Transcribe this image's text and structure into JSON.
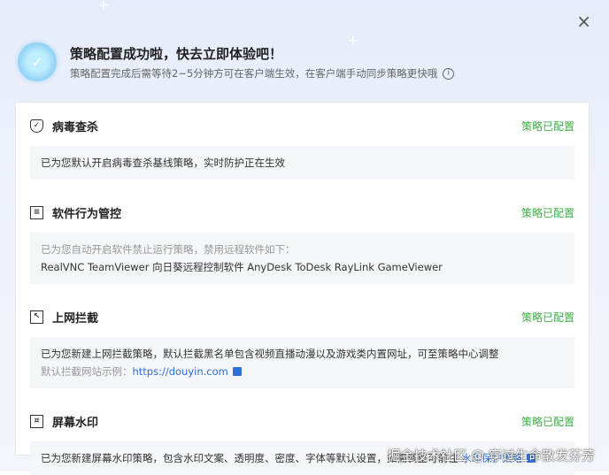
{
  "header": {
    "title": "策略配置成功啦，快去立即体验吧！",
    "subtitle": "策略配置完成后需等待2~5分钟方可在客户端生效，在客户端手动同步策略更快哦",
    "close": "×"
  },
  "sections": [
    {
      "title": "病毒查杀",
      "status": "策略已配置",
      "line1": "已为您默认开启病毒查杀基线策略，实时防护正在生效"
    },
    {
      "title": "软件行为管控",
      "status": "策略已配置",
      "line1": "已为您自动开启软件禁止运行策略，禁用远程软件如下：",
      "line2": "RealVNC TeamViewer 向日葵远程控制软件 AnyDesk ToDesk RayLink GameViewer"
    },
    {
      "title": "上网拦截",
      "status": "策略已配置",
      "line1": "已为您新建上网拦截策略，默认拦截黑名单包含视频直播动漫以及游戏类内置网址，可至策略中心调整",
      "line2_label": "默认拦截网站示例：",
      "link": "https://douyin.com"
    },
    {
      "title": "屏幕水印",
      "status": "策略已配置",
      "line1": "已为您新建屏幕水印策略，包含水印文案、透明度、密度、字体等默认设置，如需调整可前往",
      "link": "水印保护策略"
    }
  ],
  "watermark": "掘金技术社区 @ 穿过生命散发芬芳"
}
